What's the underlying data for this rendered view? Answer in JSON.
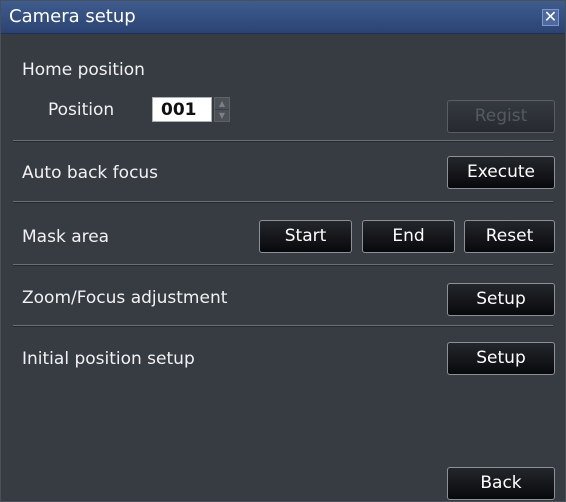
{
  "window": {
    "title": "Camera setup",
    "close_glyph": "✕"
  },
  "home_position": {
    "heading": "Home position",
    "position_label": "Position",
    "position_value": "001",
    "regist_label": "Regist",
    "regist_enabled": false
  },
  "auto_back_focus": {
    "label": "Auto back focus",
    "execute_label": "Execute"
  },
  "mask_area": {
    "label": "Mask area",
    "start_label": "Start",
    "end_label": "End",
    "reset_label": "Reset"
  },
  "zoom_focus": {
    "label": "Zoom/Focus adjustment",
    "setup_label": "Setup"
  },
  "initial_position": {
    "label": "Initial position setup",
    "setup_label": "Setup"
  },
  "footer": {
    "back_label": "Back"
  },
  "colors": {
    "panel_bg": "#373c43",
    "titlebar": "#2f4a7d",
    "button_bg": "#0f1113",
    "text": "#f0f0f0"
  },
  "icons": {
    "close": "close-icon",
    "spinner_up": "spinner-up-icon",
    "spinner_down": "spinner-down-icon"
  }
}
